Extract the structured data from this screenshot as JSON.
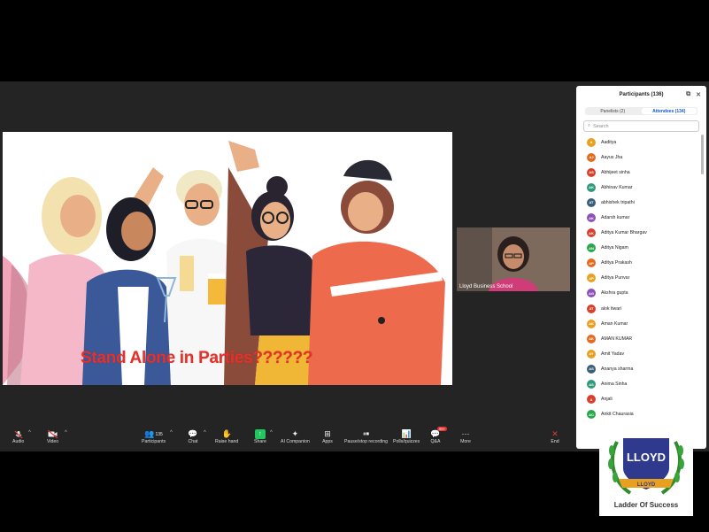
{
  "slide": {
    "caption": "Stand Alone in Parties??????"
  },
  "video": {
    "name": "Lloyd Business School"
  },
  "toolbar": {
    "audio": "Audio",
    "video": "Video",
    "participants": "Participants",
    "participants_count": "135",
    "chat": "Chat",
    "raise_hand": "Raise hand",
    "share": "Share",
    "ai": "AI Companion",
    "apps": "Apps",
    "record": "Pause/stop recording",
    "polls": "Polls/quizzes",
    "qa": "Q&A",
    "qa_badge": "99+",
    "more": "More",
    "end": "End"
  },
  "panel": {
    "title": "Participants (136)",
    "tab_panelists": "Panelists (2)",
    "tab_attendees": "Attendees (134)",
    "search_placeholder": "Search",
    "attendees": [
      {
        "initials": "A",
        "name": "Aaditya",
        "color": "#e8a020"
      },
      {
        "initials": "AJ",
        "name": "Aayus Jha",
        "color": "#e36a1f"
      },
      {
        "initials": "AS",
        "name": "Abhijeet sinha",
        "color": "#d8402d"
      },
      {
        "initials": "AK",
        "name": "Abhinav Kumar",
        "color": "#2d9c7a"
      },
      {
        "initials": "AT",
        "name": "abhishek tripathi",
        "color": "#3a5f7a"
      },
      {
        "initials": "AK",
        "name": "Adarsh kumar",
        "color": "#8d4fb8"
      },
      {
        "initials": "AK",
        "name": "Aditya Kumar Bhargav",
        "color": "#d8402d"
      },
      {
        "initials": "AN",
        "name": "Aditya Nigam",
        "color": "#28a84a"
      },
      {
        "initials": "AP",
        "name": "Aditya Prakash",
        "color": "#e36a1f"
      },
      {
        "initials": "AP",
        "name": "Aditya Punvar",
        "color": "#e8a020"
      },
      {
        "initials": "AG",
        "name": "Akshra gupta",
        "color": "#8d4fb8"
      },
      {
        "initials": "AT",
        "name": "alok tiwari",
        "color": "#d8402d"
      },
      {
        "initials": "AK",
        "name": "Aman Kumar",
        "color": "#e8a020"
      },
      {
        "initials": "AK",
        "name": "AMAN KUMAR",
        "color": "#e36a1f"
      },
      {
        "initials": "AY",
        "name": "Amit Yadav",
        "color": "#e8a020"
      },
      {
        "initials": "AS",
        "name": "Ananya sharma",
        "color": "#3a5f7a"
      },
      {
        "initials": "AS",
        "name": "Anima Sinha",
        "color": "#2d9c7a"
      },
      {
        "initials": "A",
        "name": "Anjali",
        "color": "#d8402d"
      },
      {
        "initials": "AC",
        "name": "Ankit Chaurasia",
        "color": "#28a84a"
      }
    ]
  },
  "logo": {
    "brand": "LLOYD",
    "ribbon": "LLOYD",
    "tagline": "Ladder Of Success"
  }
}
